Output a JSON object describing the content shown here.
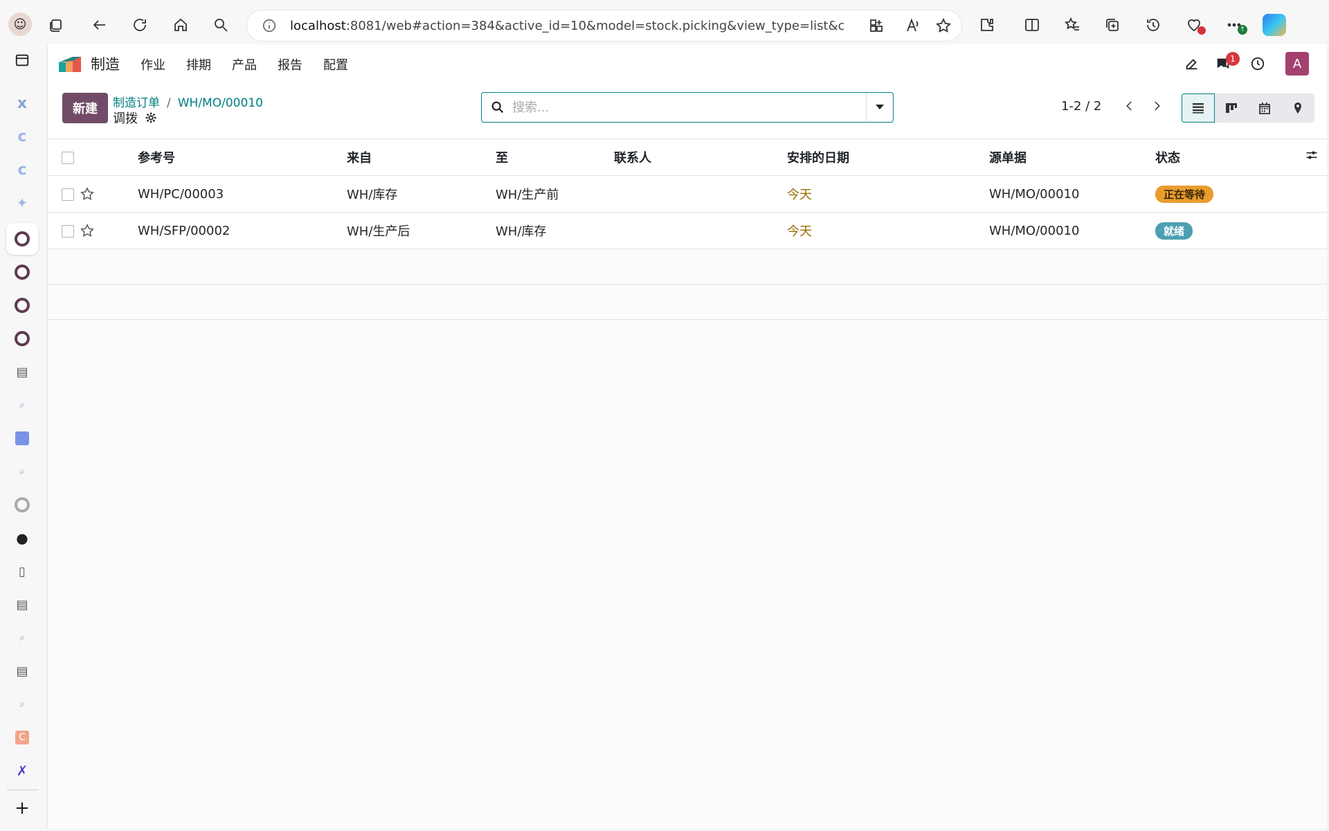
{
  "browser": {
    "url_host": "localhost",
    "url_rest": ":8081/web#action=384&active_id=10&model=stock.picking&view_type=list&ci..."
  },
  "app": {
    "name": "制造",
    "menu": [
      "作业",
      "排期",
      "产品",
      "报告",
      "配置"
    ],
    "chat_badge": "1",
    "user_initial": "A"
  },
  "control": {
    "new_label": "新建",
    "breadcrumb": [
      "制造订单",
      "WH/MO/00010"
    ],
    "breadcrumb_sep": "/",
    "subtitle": "调拨",
    "search_placeholder": "搜索...",
    "pager": "1-2 / 2"
  },
  "table": {
    "columns": [
      "参考号",
      "来自",
      "至",
      "联系人",
      "安排的日期",
      "源单据",
      "状态"
    ],
    "rows": [
      {
        "ref": "WH/PC/00003",
        "from": "WH/库存",
        "to": "WH/生产前",
        "contact": "",
        "date": "今天",
        "source": "WH/MO/00010",
        "status": "正在等待",
        "status_kind": "waiting"
      },
      {
        "ref": "WH/SFP/00002",
        "from": "WH/生产后",
        "to": "WH/库存",
        "contact": "",
        "date": "今天",
        "source": "WH/MO/00010",
        "status": "就绪",
        "status_kind": "ready"
      }
    ]
  },
  "colors": {
    "brand": "#714b67",
    "link": "#017e84",
    "waiting": "#e99d2f",
    "ready": "#4d9fb3"
  }
}
